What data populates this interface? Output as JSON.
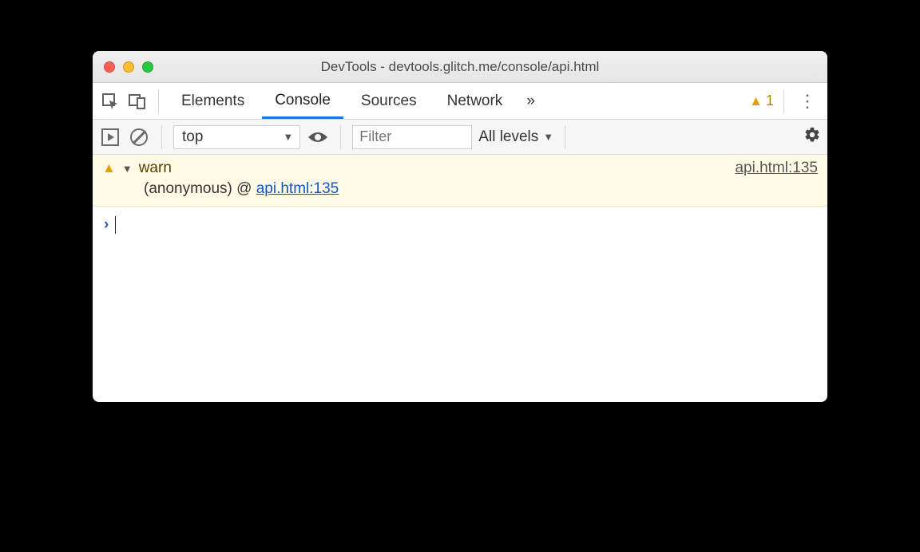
{
  "window": {
    "title": "DevTools - devtools.glitch.me/console/api.html"
  },
  "tabs": {
    "items": [
      "Elements",
      "Console",
      "Sources",
      "Network"
    ],
    "active": "Console",
    "overflow_glyph": "»",
    "warn_count": "1",
    "menu_glyph": "⋮"
  },
  "toolbar": {
    "context": "top",
    "filter_placeholder": "Filter",
    "levels_label": "All levels"
  },
  "console": {
    "entries": [
      {
        "type": "warn",
        "name": "warn",
        "source": "api.html:135",
        "trace_label": "(anonymous) @ ",
        "trace_link": "api.html:135"
      }
    ],
    "prompt_glyph": "›"
  }
}
